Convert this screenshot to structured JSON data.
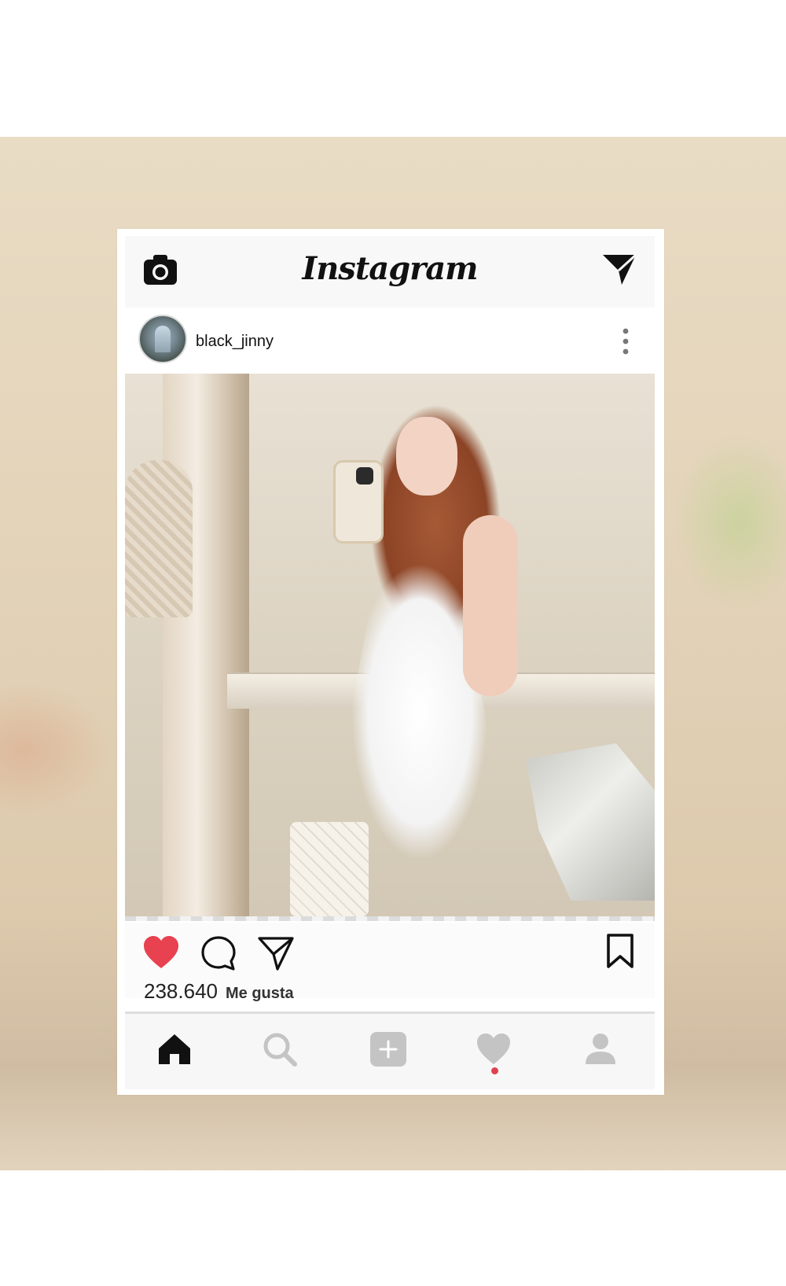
{
  "app": {
    "name": "Instagram"
  },
  "post": {
    "username": "black_jinny",
    "likes_count": "238.640",
    "likes_label": "Me gusta",
    "liked": true
  },
  "icons": {
    "camera": "camera-icon",
    "direct": "paper-plane-icon",
    "more": "more-vertical-icon",
    "like": "heart-icon",
    "comment": "comment-icon",
    "share": "paper-plane-icon",
    "save": "bookmark-icon"
  },
  "bottom_nav": [
    {
      "name": "home",
      "icon": "home-icon",
      "active": true
    },
    {
      "name": "search",
      "icon": "search-icon",
      "active": false
    },
    {
      "name": "add",
      "icon": "add-icon",
      "active": false
    },
    {
      "name": "activity",
      "icon": "heart-icon",
      "active": false,
      "notification": true
    },
    {
      "name": "profile",
      "icon": "user-icon",
      "active": false
    }
  ],
  "colors": {
    "like_red": "#e8414f",
    "nav_inactive": "#c4c4c4",
    "text": "#111111"
  }
}
